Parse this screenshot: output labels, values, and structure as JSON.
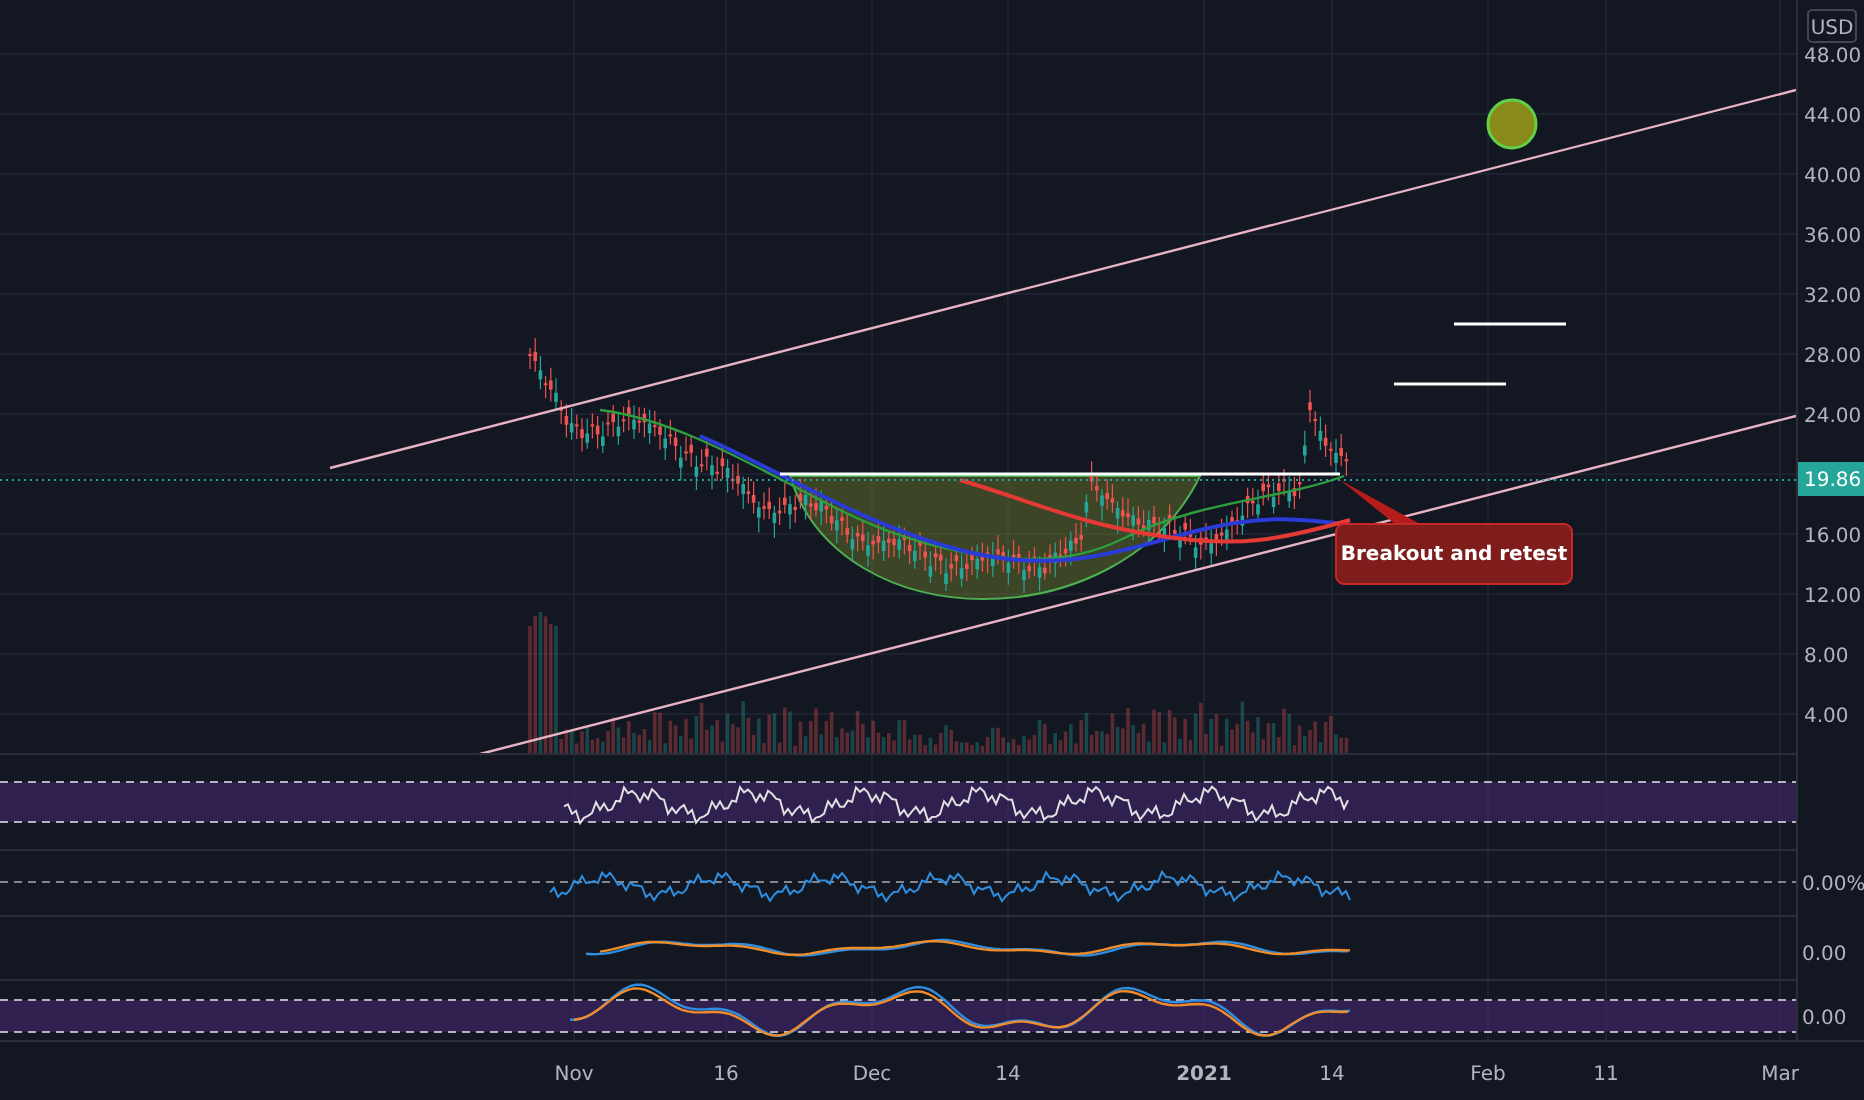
{
  "currency": "USD",
  "price_axis": [
    "48.00",
    "44.00",
    "40.00",
    "36.00",
    "32.00",
    "28.00",
    "24.00",
    "16.00",
    "12.00",
    "8.00",
    "4.00"
  ],
  "last_price": "19.86",
  "annotation": {
    "text": "Breakout and retest"
  },
  "indicator_axes": [
    "0.00%",
    "0.00",
    "0.00"
  ],
  "time_axis": [
    {
      "label": "Nov",
      "kind": "month"
    },
    {
      "label": "16",
      "kind": "day"
    },
    {
      "label": "Dec",
      "kind": "month"
    },
    {
      "label": "14",
      "kind": "day"
    },
    {
      "label": "2021",
      "kind": "year"
    },
    {
      "label": "14",
      "kind": "day"
    },
    {
      "label": "Feb",
      "kind": "month"
    },
    {
      "label": "11",
      "kind": "day"
    },
    {
      "label": "Mar",
      "kind": "month"
    }
  ]
}
